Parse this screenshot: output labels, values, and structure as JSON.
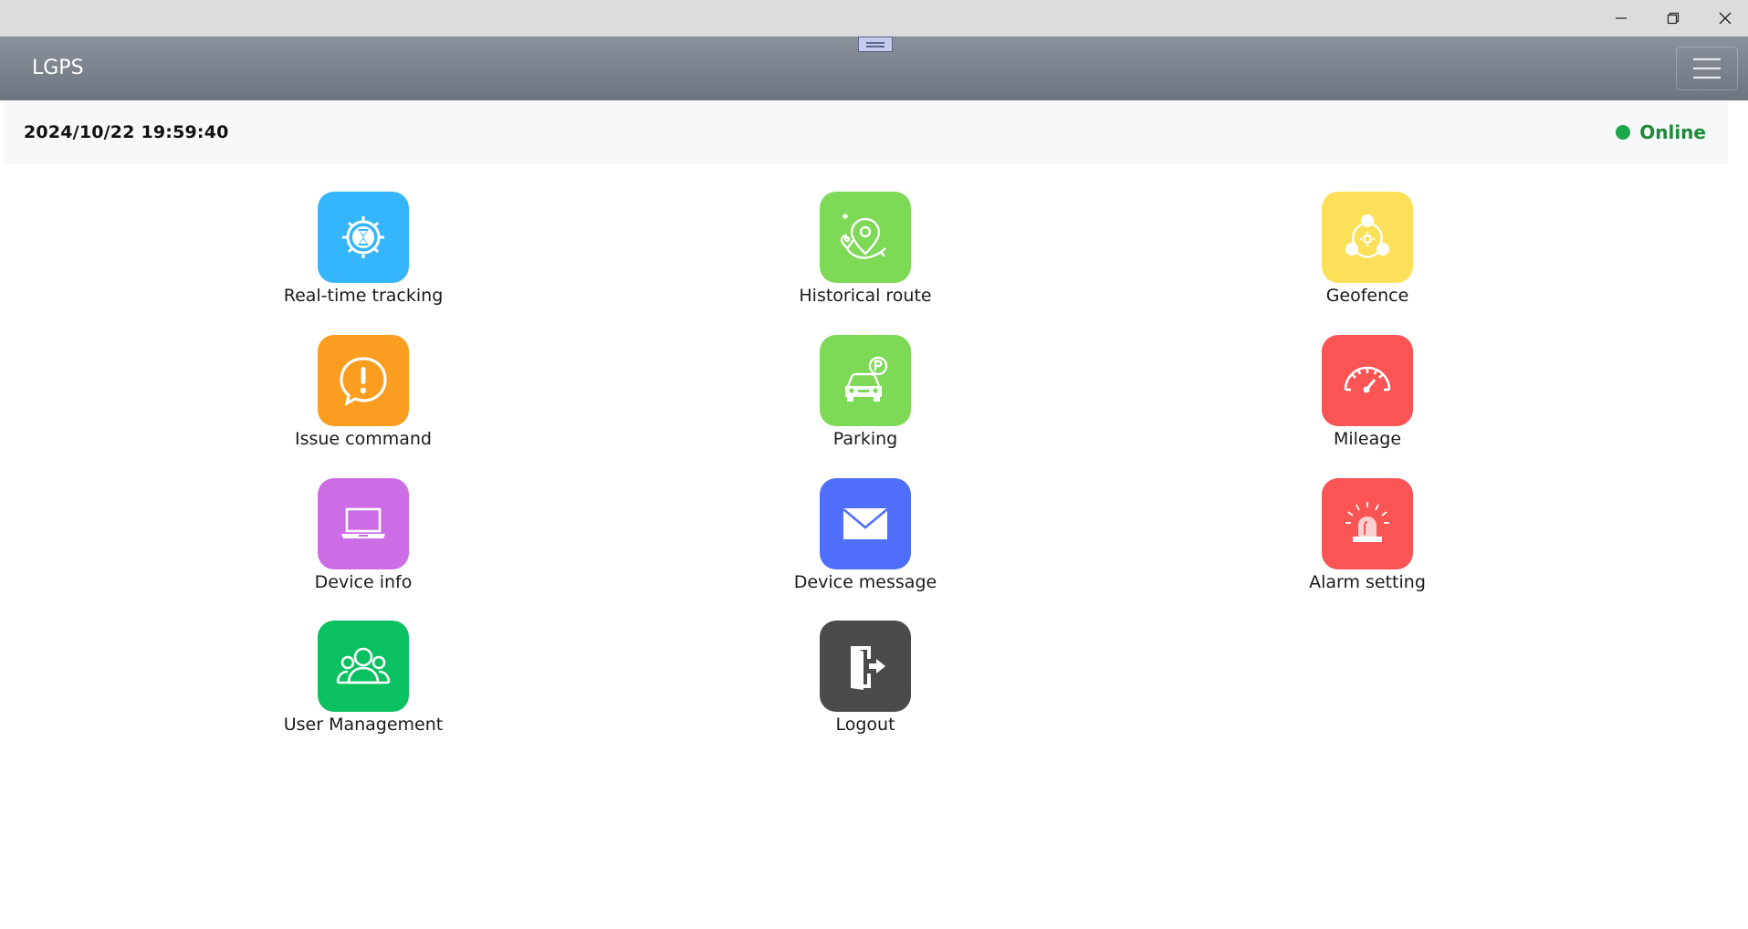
{
  "titlebar": {
    "controls": [
      "minimize",
      "restore",
      "close"
    ]
  },
  "navbar": {
    "brand": "LGPS",
    "menu_icon": "hamburger-menu-icon"
  },
  "status": {
    "datetime": "2024/10/22 19:59:40",
    "connection": "Online",
    "connection_color": "#1ea64b"
  },
  "menu": {
    "items": [
      {
        "label": "Real-time tracking",
        "icon": "realtime-tracking-icon",
        "color": "#36b6fa"
      },
      {
        "label": "Historical route",
        "icon": "historical-route-icon",
        "color": "#7ed957"
      },
      {
        "label": "Geofence",
        "icon": "geofence-icon",
        "color": "#fde05a"
      },
      {
        "label": "Issue command",
        "icon": "issue-command-icon",
        "color": "#fb9d1e"
      },
      {
        "label": "Parking",
        "icon": "parking-icon",
        "color": "#7ed957"
      },
      {
        "label": "Mileage",
        "icon": "mileage-icon",
        "color": "#fa5454"
      },
      {
        "label": "Device info",
        "icon": "device-info-icon",
        "color": "#cd6de6"
      },
      {
        "label": "Device message",
        "icon": "device-message-icon",
        "color": "#4f6ffb"
      },
      {
        "label": "Alarm setting",
        "icon": "alarm-setting-icon",
        "color": "#fa5454"
      },
      {
        "label": "User Management",
        "icon": "user-management-icon",
        "color": "#0bc061"
      },
      {
        "label": "Logout",
        "icon": "logout-icon",
        "color": "#4b4b4b"
      }
    ]
  }
}
